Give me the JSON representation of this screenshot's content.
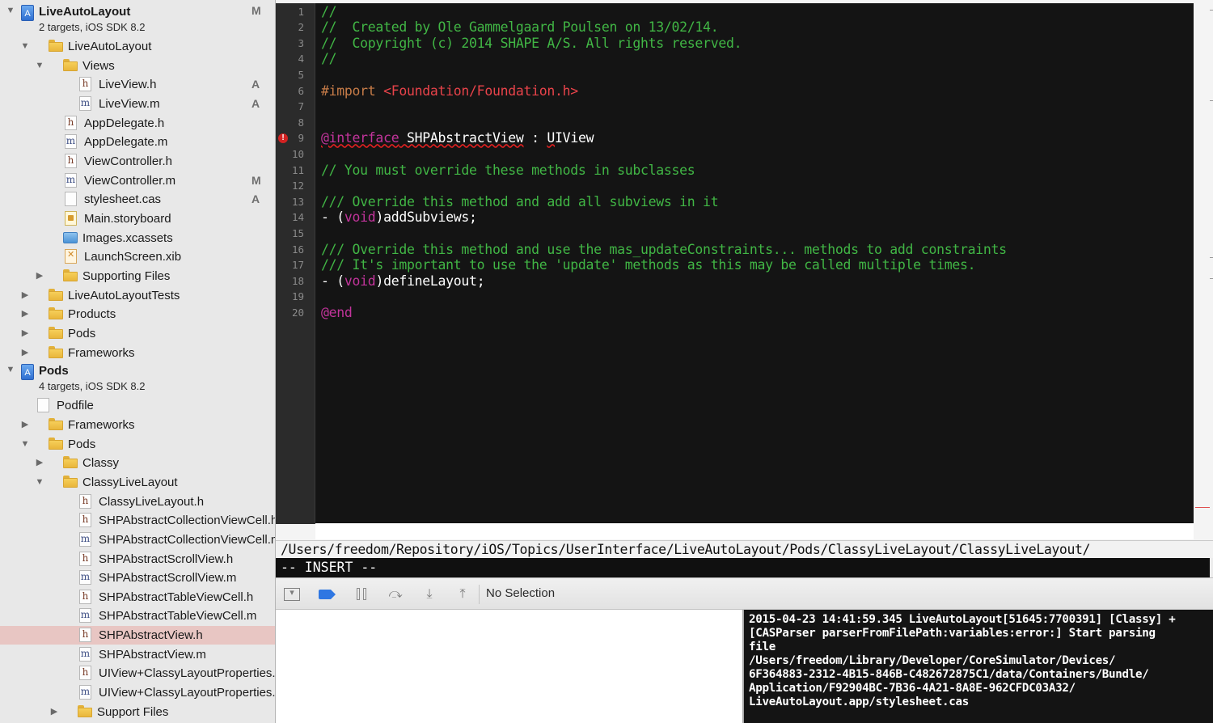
{
  "navigator": {
    "rows": [
      {
        "type": "project",
        "depth": 0,
        "expanded": true,
        "label": "LiveAutoLayout",
        "subtitle": "2 targets, iOS SDK 8.2",
        "status": "M"
      },
      {
        "type": "folder",
        "depth": 1,
        "expanded": true,
        "label": "LiveAutoLayout"
      },
      {
        "type": "folder",
        "depth": 2,
        "expanded": true,
        "label": "Views"
      },
      {
        "type": "h",
        "depth": 3,
        "label": "LiveView.h",
        "status": "A"
      },
      {
        "type": "m",
        "depth": 3,
        "label": "LiveView.m",
        "status": "A"
      },
      {
        "type": "h",
        "depth": 2,
        "label": "AppDelegate.h"
      },
      {
        "type": "m",
        "depth": 2,
        "label": "AppDelegate.m"
      },
      {
        "type": "h",
        "depth": 2,
        "label": "ViewController.h"
      },
      {
        "type": "m",
        "depth": 2,
        "label": "ViewController.m",
        "status": "M"
      },
      {
        "type": "cas",
        "depth": 2,
        "label": "stylesheet.cas",
        "status": "A"
      },
      {
        "type": "storyboard",
        "depth": 2,
        "label": "Main.storyboard"
      },
      {
        "type": "xcassets",
        "depth": 2,
        "label": "Images.xcassets"
      },
      {
        "type": "xib",
        "depth": 2,
        "label": "LaunchScreen.xib"
      },
      {
        "type": "folder",
        "depth": 2,
        "expanded": false,
        "label": "Supporting Files"
      },
      {
        "type": "folder",
        "depth": 1,
        "expanded": false,
        "label": "LiveAutoLayoutTests"
      },
      {
        "type": "folder",
        "depth": 1,
        "expanded": false,
        "label": "Products"
      },
      {
        "type": "folder",
        "depth": 1,
        "expanded": false,
        "label": "Pods"
      },
      {
        "type": "folder",
        "depth": 1,
        "expanded": false,
        "label": "Frameworks"
      },
      {
        "type": "project",
        "depth": 0,
        "expanded": true,
        "label": "Pods",
        "subtitle": "4 targets, iOS SDK 8.2"
      },
      {
        "type": "podfile",
        "depth": 2,
        "label": "Podfile"
      },
      {
        "type": "folder",
        "depth": 1,
        "expanded": false,
        "label": "Frameworks"
      },
      {
        "type": "folder",
        "depth": 1,
        "expanded": true,
        "label": "Pods"
      },
      {
        "type": "folder",
        "depth": 2,
        "expanded": false,
        "label": "Classy"
      },
      {
        "type": "folder",
        "depth": 2,
        "expanded": true,
        "label": "ClassyLiveLayout"
      },
      {
        "type": "h",
        "depth": 3,
        "label": "ClassyLiveLayout.h"
      },
      {
        "type": "h",
        "depth": 3,
        "label": "SHPAbstractCollectionViewCell.h"
      },
      {
        "type": "m",
        "depth": 3,
        "label": "SHPAbstractCollectionViewCell.m"
      },
      {
        "type": "h",
        "depth": 3,
        "label": "SHPAbstractScrollView.h"
      },
      {
        "type": "m",
        "depth": 3,
        "label": "SHPAbstractScrollView.m"
      },
      {
        "type": "h",
        "depth": 3,
        "label": "SHPAbstractTableViewCell.h"
      },
      {
        "type": "m",
        "depth": 3,
        "label": "SHPAbstractTableViewCell.m"
      },
      {
        "type": "h",
        "depth": 3,
        "label": "SHPAbstractView.h",
        "selected": true
      },
      {
        "type": "m",
        "depth": 3,
        "label": "SHPAbstractView.m"
      },
      {
        "type": "h",
        "depth": 3,
        "label": "UIView+ClassyLayoutProperties.h"
      },
      {
        "type": "m",
        "depth": 3,
        "label": "UIView+ClassyLayoutProperties.m"
      },
      {
        "type": "folder",
        "depth": 3,
        "expanded": false,
        "label": "Support Files"
      }
    ]
  },
  "editor": {
    "lines": [
      [
        {
          "c": "comment",
          "t": "//"
        }
      ],
      [
        {
          "c": "comment",
          "t": "//  Created by Ole Gammelgaard Poulsen on 13/02/14."
        }
      ],
      [
        {
          "c": "comment",
          "t": "//  Copyright (c) 2014 SHAPE A/S. All rights reserved."
        }
      ],
      [
        {
          "c": "comment",
          "t": "//"
        }
      ],
      [],
      [
        {
          "c": "pre",
          "t": "#import "
        },
        {
          "c": "str",
          "t": "<Foundation/Foundation.h>"
        }
      ],
      [],
      [],
      [
        {
          "c": "kw err",
          "t": "@interface"
        },
        {
          "c": "plain err",
          "t": " SHPAbstractView"
        },
        {
          "c": "plain",
          "t": " : "
        },
        {
          "c": "plain warn",
          "t": "U"
        },
        {
          "c": "plain",
          "t": "IView"
        }
      ],
      [],
      [
        {
          "c": "comment",
          "t": "// You must override these methods in subclasses"
        }
      ],
      [],
      [
        {
          "c": "comment",
          "t": "/// Override this method and add all subviews in it"
        }
      ],
      [
        {
          "c": "plain",
          "t": "- ("
        },
        {
          "c": "kw",
          "t": "void"
        },
        {
          "c": "plain",
          "t": ")addSubviews;"
        }
      ],
      [],
      [
        {
          "c": "comment",
          "t": "/// Override this method and use the mas_updateConstraints... methods to add constraints"
        }
      ],
      [
        {
          "c": "comment",
          "t": "/// It's important to use the 'update' methods as this may be called multiple times."
        }
      ],
      [
        {
          "c": "plain",
          "t": "- ("
        },
        {
          "c": "kw",
          "t": "void"
        },
        {
          "c": "plain",
          "t": ")defineLayout;"
        }
      ],
      [],
      [
        {
          "c": "kw",
          "t": "@end"
        }
      ]
    ],
    "error_line": 9
  },
  "vim": {
    "path": "/Users/freedom/Repository/iOS/Topics/UserInterface/LiveAutoLayout/Pods/ClassyLiveLayout/ClassyLiveLayout/",
    "mode": "-- INSERT --"
  },
  "debug_bar": {
    "selection_label": "No Selection"
  },
  "console": {
    "text": "2015-04-23 14:41:59.345 LiveAutoLayout[51645:7700391] [Classy] +\n[CASParser parserFromFilePath:variables:error:] Start parsing\nfile\n/Users/freedom/Library/Developer/CoreSimulator/Devices/\n6F364883-2312-4B15-846B-C482672875C1/data/Containers/Bundle/\nApplication/F92904BC-7B36-4A21-8A8E-962CFDC03A32/\nLiveAutoLayout.app/stylesheet.cas"
  }
}
